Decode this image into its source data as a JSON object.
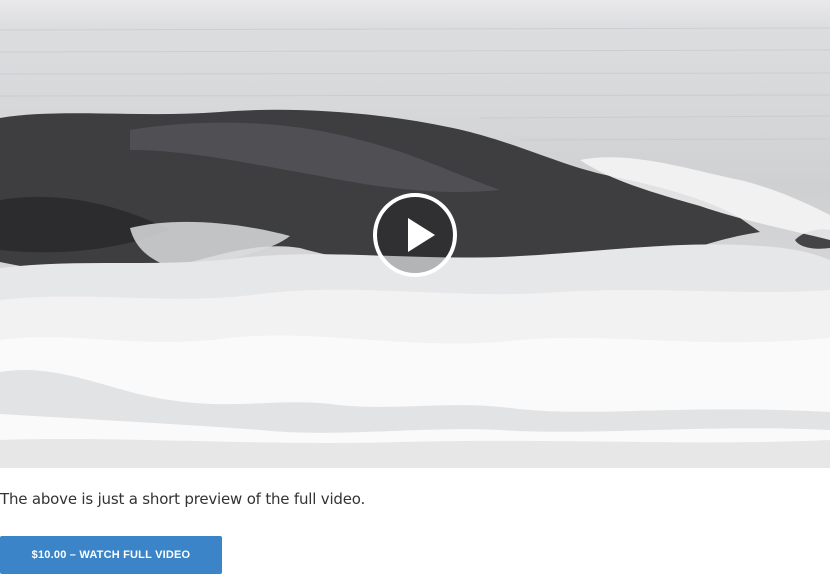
{
  "video": {
    "play_icon": "play-icon"
  },
  "caption": "The above is just a short preview of the full video.",
  "buy_button": {
    "label": "$10.00 – WATCH FULL VIDEO",
    "color": "#3a84c7"
  }
}
